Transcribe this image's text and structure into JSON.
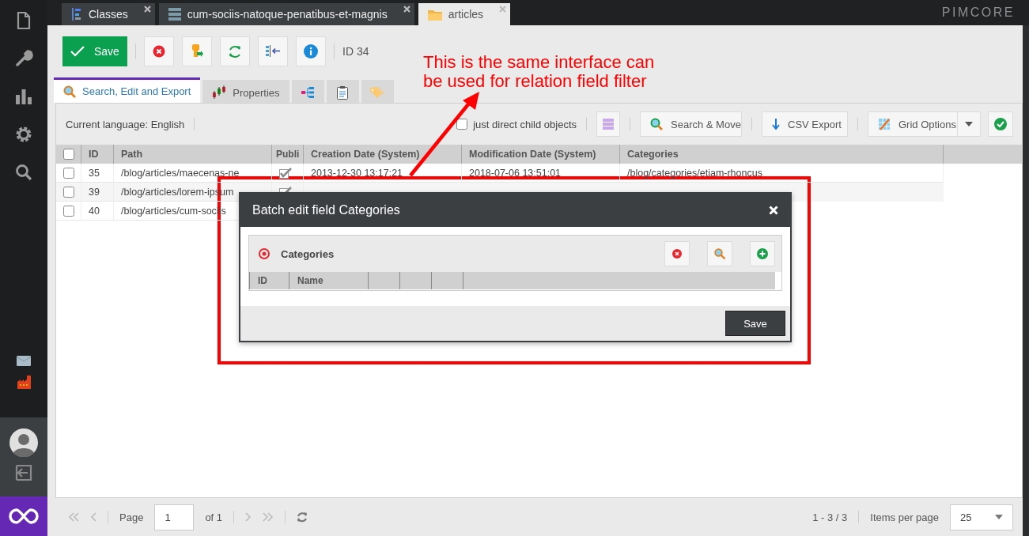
{
  "tabs": [
    {
      "label": "Classes",
      "selected": false
    },
    {
      "label": "cum-sociis-natoque-penatibus-et-magnis",
      "selected": false
    },
    {
      "label": "articles",
      "selected": true
    }
  ],
  "brand": "PIMCORE",
  "toolbar": {
    "save": "Save",
    "id_label": "ID 34"
  },
  "subtabs": [
    {
      "label": "Search, Edit and Export",
      "selected": true
    },
    {
      "label": "Properties",
      "selected": false
    },
    {
      "selected": false
    },
    {
      "selected": false
    },
    {
      "selected": false
    }
  ],
  "grid_toolbar": {
    "language": "Current language: English",
    "direct_children": {
      "label": "just direct child objects",
      "checked": false
    },
    "buttons": [
      "Search & Move",
      "CSV Export",
      "Grid Options"
    ]
  },
  "grid": {
    "all_checked": false,
    "columns": [
      "ID",
      "Path",
      "Publi",
      "Creation Date (System)",
      "Modification Date (System)",
      "Categories"
    ],
    "rows": [
      {
        "checked": false,
        "published": true,
        "cells": [
          "35",
          "/blog/articles/maecenas-ne",
          "",
          "2013-12-30 13:17:21",
          "2018-07-06 13:51:01",
          "/blog/categories/etiam-rhoncus"
        ]
      },
      {
        "checked": false,
        "published": true,
        "cells": [
          "39",
          "/blog/articles/lorem-ipsum",
          ""
        ]
      },
      {
        "checked": false,
        "cells": [
          "40",
          "/blog/articles/cum-sociis"
        ]
      }
    ]
  },
  "pager": {
    "page_label": "Page",
    "page": "1",
    "of": "of 1",
    "summary": "1 - 3 / 3",
    "per_page_label": "Items per page",
    "per_page": "25"
  },
  "dialog": {
    "title": "Batch edit field Categories",
    "panel_title": "Categories",
    "columns": [
      "ID",
      "Name"
    ],
    "save": "Save"
  },
  "annotation": {
    "lines": [
      "This is the same interface can",
      "be used for relation field filter"
    ]
  }
}
